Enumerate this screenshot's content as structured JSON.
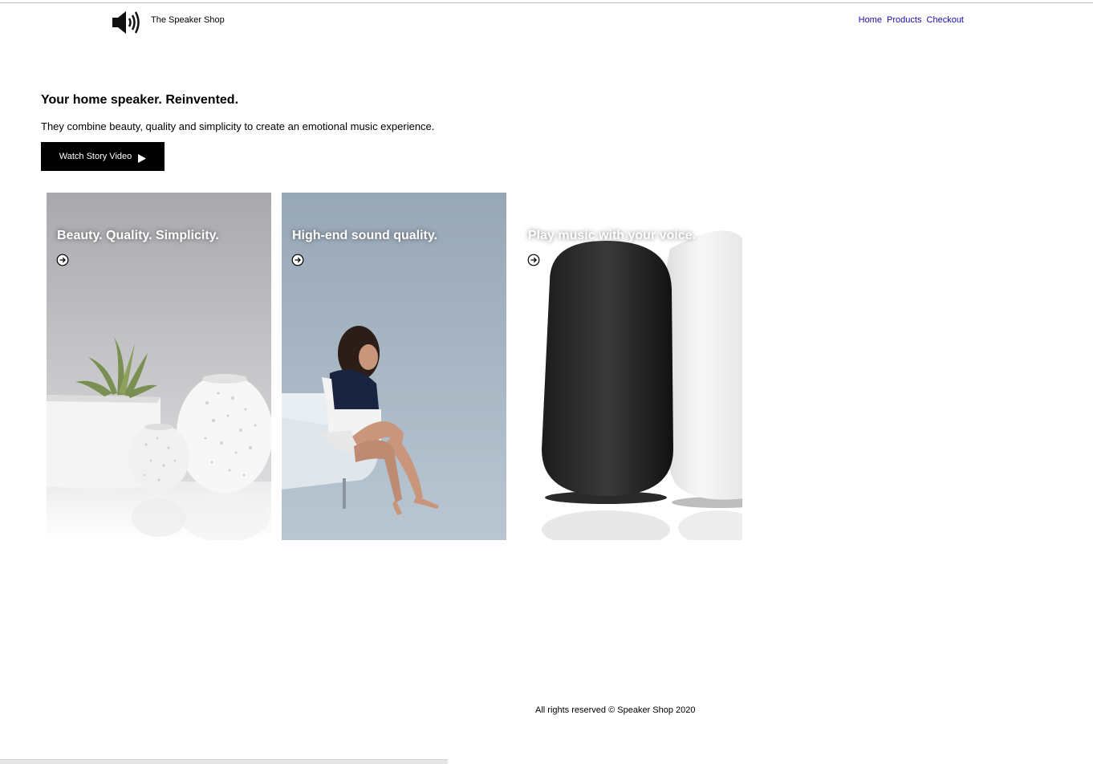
{
  "header": {
    "logo_icon": "speaker-volume-icon",
    "brand": "The Speaker Shop",
    "nav": [
      {
        "label": "Home"
      },
      {
        "label": "Products"
      },
      {
        "label": "Checkout"
      }
    ],
    "link_color": "#1a0dab"
  },
  "hero": {
    "title": "Your home speaker. Reinvented.",
    "subtitle": "They combine beauty, quality and simplicity to create an emotional music experience.",
    "button_label": "Watch Story Video",
    "button_icon": "play-icon"
  },
  "cards": [
    {
      "title": "Beauty. Quality. Simplicity.",
      "icon": "arrow-right-circle-icon"
    },
    {
      "title": "High-end sound quality.",
      "icon": "arrow-right-circle-icon"
    },
    {
      "title": "Play music with your voice.",
      "icon": "arrow-right-circle-icon"
    }
  ],
  "footer": {
    "text": "All rights reserved © Speaker Shop 2020"
  }
}
